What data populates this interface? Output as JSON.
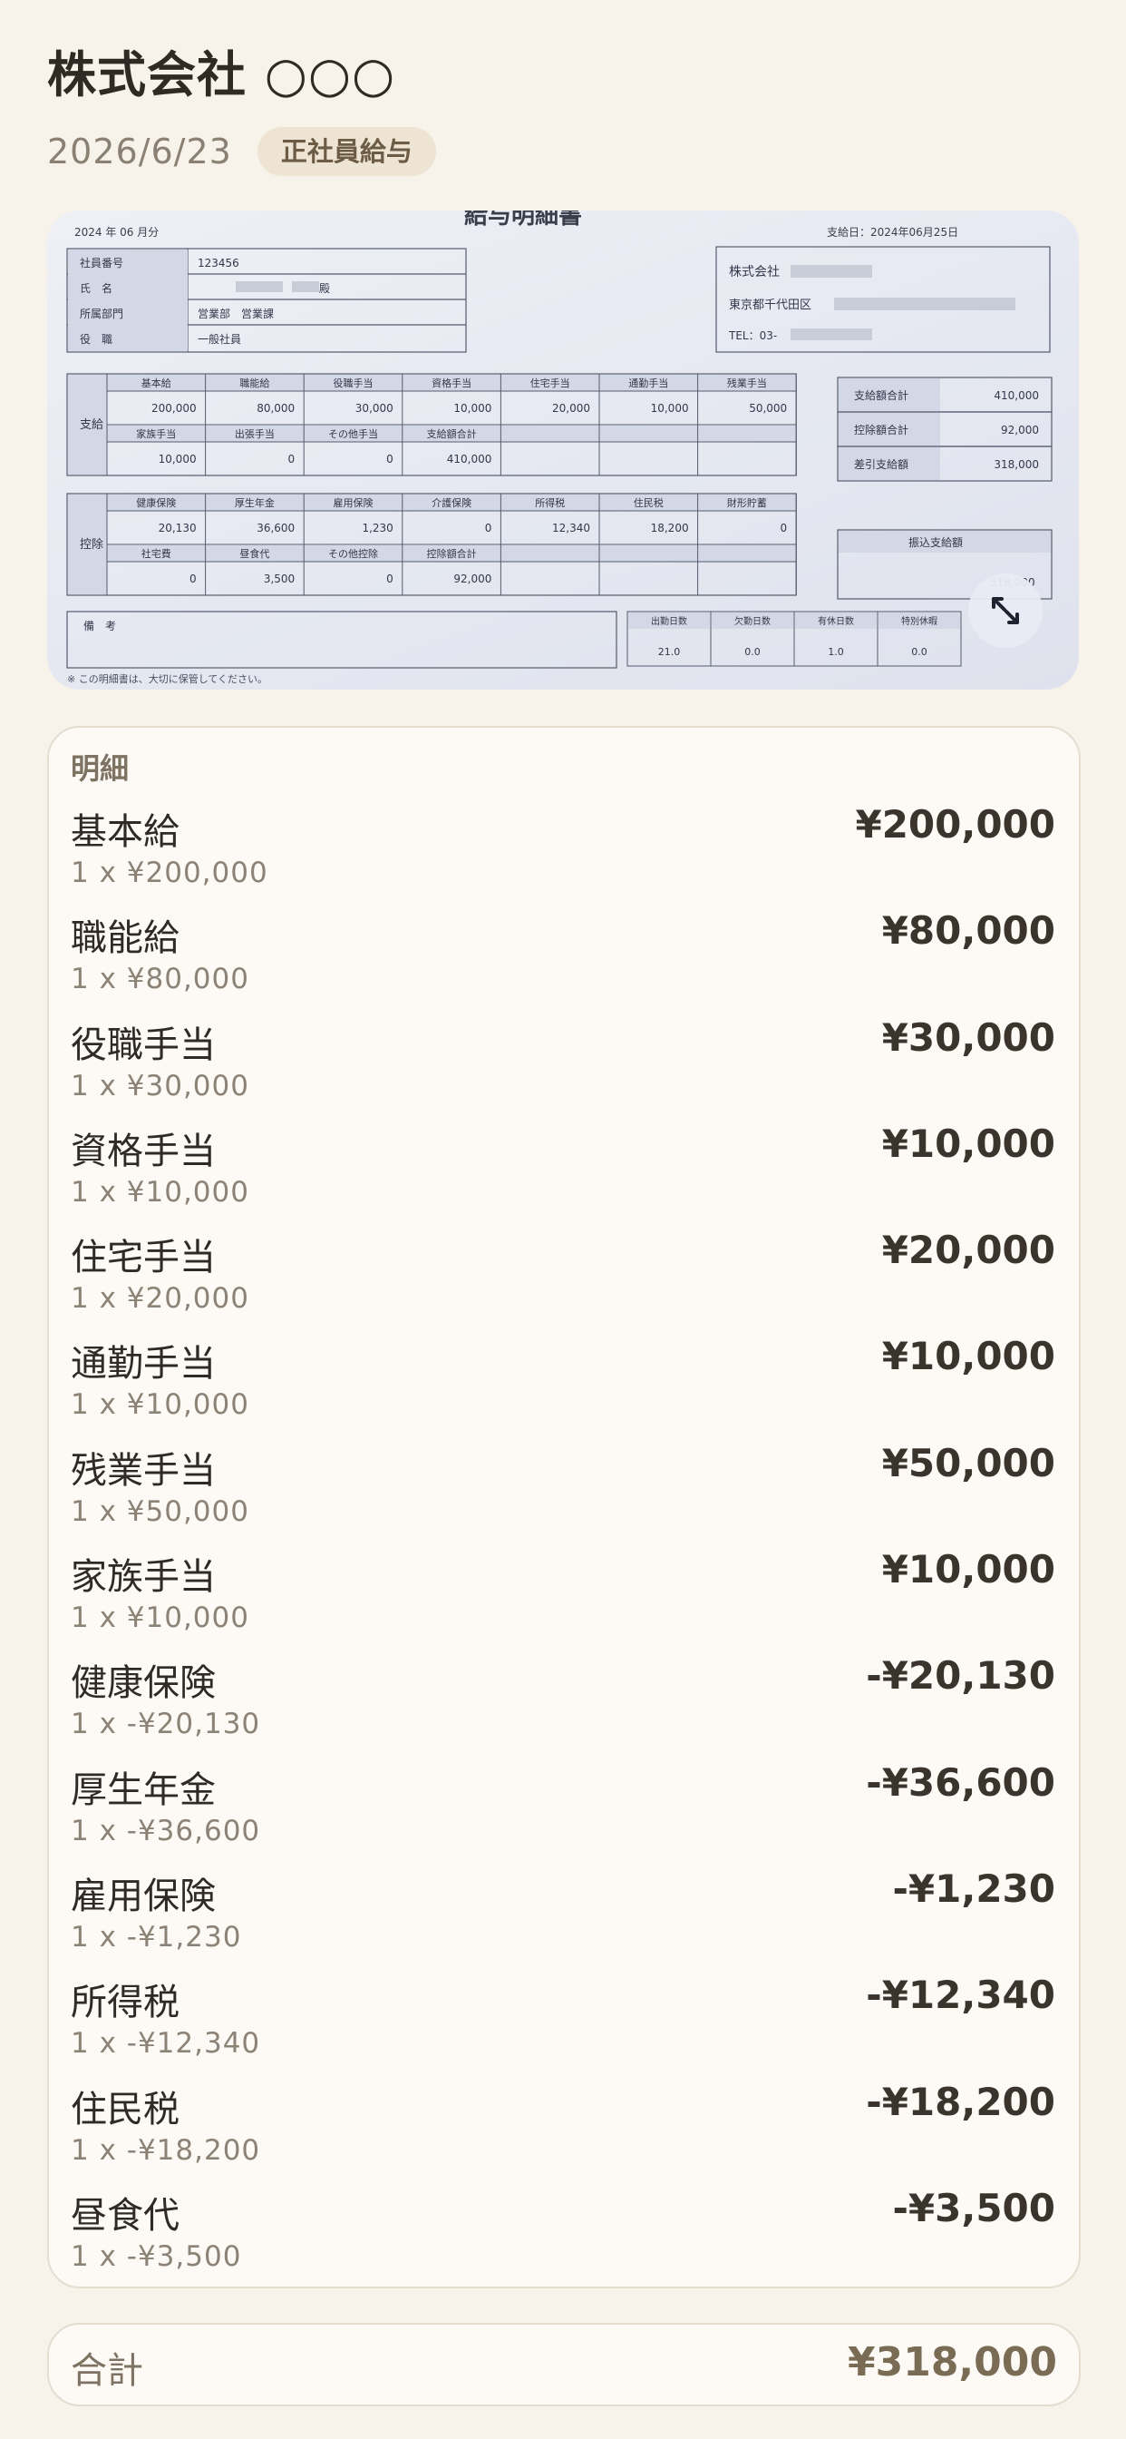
{
  "header": {
    "company": "株式会社 ○○○",
    "date": "2026/6/23",
    "category_badge": "正社員給与"
  },
  "receipt_image": {
    "doc_title": "給与明細書",
    "period": "2024 年 06 月分",
    "pay_date": "支給日：2024年06月25日",
    "employee_fields": [
      {
        "label": "社員番号",
        "value": "123456"
      },
      {
        "label": "氏　名",
        "value": "殿"
      },
      {
        "label": "所属部門",
        "value": "営業部　営業課"
      },
      {
        "label": "役　職",
        "value": "一般社員"
      }
    ],
    "company_box": {
      "name": "株式会社",
      "address": "東京都千代田区",
      "tel": "TEL：03-"
    },
    "pay_section_label": "支給",
    "pay_headers_1": [
      "基本給",
      "職能給",
      "役職手当",
      "資格手当",
      "住宅手当",
      "通勤手当",
      "残業手当"
    ],
    "pay_values_1": [
      "200,000",
      "80,000",
      "30,000",
      "10,000",
      "20,000",
      "10,000",
      "50,000"
    ],
    "pay_headers_2": [
      "家族手当",
      "出張手当",
      "その他手当",
      "支給額合計",
      "",
      "",
      ""
    ],
    "pay_values_2": [
      "10,000",
      "0",
      "0",
      "410,000",
      "",
      "",
      ""
    ],
    "deduction_section_label": "控除",
    "ded_headers_1": [
      "健康保険",
      "厚生年金",
      "雇用保険",
      "介護保険",
      "所得税",
      "住民税",
      "財形貯蓄"
    ],
    "ded_values_1": [
      "20,130",
      "36,600",
      "1,230",
      "0",
      "12,340",
      "18,200",
      "0"
    ],
    "ded_headers_2": [
      "社宅費",
      "昼食代",
      "その他控除",
      "控除額合計",
      "",
      "",
      ""
    ],
    "ded_values_2": [
      "0",
      "3,500",
      "0",
      "92,000",
      "",
      "",
      ""
    ],
    "summary": [
      {
        "label": "支給額合計",
        "value": "410,000"
      },
      {
        "label": "控除額合計",
        "value": "92,000"
      },
      {
        "label": "差引支給額",
        "value": "318,000"
      }
    ],
    "transfer_label": "振込支給額",
    "transfer_value": "318,000",
    "remarks_label": "備　考",
    "attendance_headers": [
      "出勤日数",
      "欠勤日数",
      "有休日数",
      "特別休暇"
    ],
    "attendance_values": [
      "21.0",
      "0.0",
      "1.0",
      "0.0"
    ],
    "footer_note": "※ この明細書は、大切に保管してください。",
    "expand_icon": "expand-arrows-icon"
  },
  "details": {
    "title": "明細",
    "items": [
      {
        "name": "基本給",
        "detail": "1 x ¥200,000",
        "amount": "¥200,000"
      },
      {
        "name": "職能給",
        "detail": "1 x ¥80,000",
        "amount": "¥80,000"
      },
      {
        "name": "役職手当",
        "detail": "1 x ¥30,000",
        "amount": "¥30,000"
      },
      {
        "name": "資格手当",
        "detail": "1 x ¥10,000",
        "amount": "¥10,000"
      },
      {
        "name": "住宅手当",
        "detail": "1 x ¥20,000",
        "amount": "¥20,000"
      },
      {
        "name": "通勤手当",
        "detail": "1 x ¥10,000",
        "amount": "¥10,000"
      },
      {
        "name": "残業手当",
        "detail": "1 x ¥50,000",
        "amount": "¥50,000"
      },
      {
        "name": "家族手当",
        "detail": "1 x ¥10,000",
        "amount": "¥10,000"
      },
      {
        "name": "健康保険",
        "detail": "1 x -¥20,130",
        "amount": "-¥20,130"
      },
      {
        "name": "厚生年金",
        "detail": "1 x -¥36,600",
        "amount": "-¥36,600"
      },
      {
        "name": "雇用保険",
        "detail": "1 x -¥1,230",
        "amount": "-¥1,230"
      },
      {
        "name": "所得税",
        "detail": "1 x -¥12,340",
        "amount": "-¥12,340"
      },
      {
        "name": "住民税",
        "detail": "1 x -¥18,200",
        "amount": "-¥18,200"
      },
      {
        "name": "昼食代",
        "detail": "1 x -¥3,500",
        "amount": "-¥3,500"
      }
    ]
  },
  "total": {
    "label": "合計",
    "value": "¥318,000"
  },
  "colors": {
    "background": "#f7f3ea",
    "accent": "#7a6b55",
    "badge_bg": "#ede4d4"
  }
}
